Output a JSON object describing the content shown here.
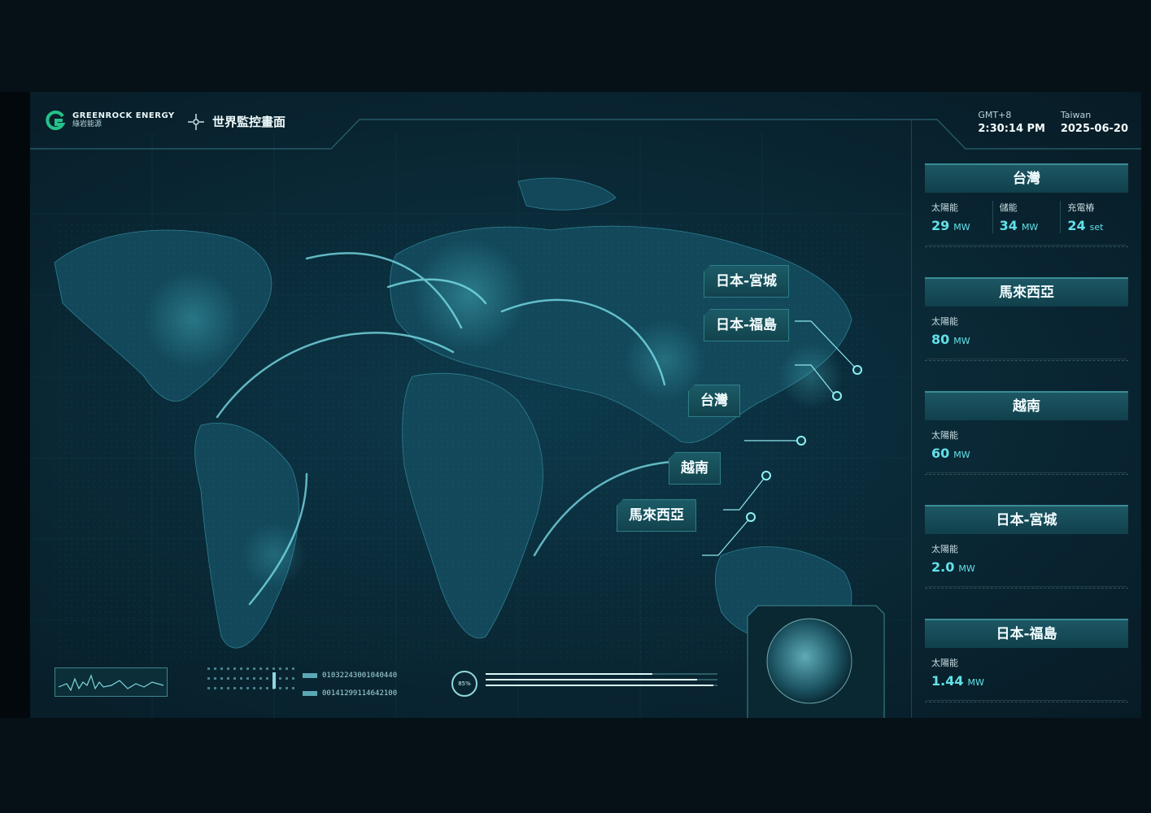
{
  "brand": {
    "name_en": "GREENROCK ENERGY",
    "name_zh": "綠岩能源"
  },
  "page_title": "世界監控畫面",
  "header": {
    "timezone_label": "GMT+8",
    "time": "2:30:14 PM",
    "location_label": "Taiwan",
    "date": "2025-06-20"
  },
  "map_callouts": [
    {
      "label": "日本-宮城"
    },
    {
      "label": "日本-福島"
    },
    {
      "label": "台灣"
    },
    {
      "label": "越南"
    },
    {
      "label": "馬來西亞"
    }
  ],
  "sites": [
    {
      "title": "台灣",
      "metrics": [
        {
          "label": "太陽能",
          "value": "29",
          "unit": "MW"
        },
        {
          "label": "儲能",
          "value": "34",
          "unit": "MW"
        },
        {
          "label": "充電樁",
          "value": "24",
          "unit": "set"
        }
      ]
    },
    {
      "title": "馬來西亞",
      "metrics": [
        {
          "label": "太陽能",
          "value": "80",
          "unit": "MW"
        }
      ]
    },
    {
      "title": "越南",
      "metrics": [
        {
          "label": "太陽能",
          "value": "60",
          "unit": "MW"
        }
      ]
    },
    {
      "title": "日本-宮城",
      "metrics": [
        {
          "label": "太陽能",
          "value": "2.0",
          "unit": "MW"
        }
      ]
    },
    {
      "title": "日本-福島",
      "metrics": [
        {
          "label": "太陽能",
          "value": "1.44",
          "unit": "MW"
        }
      ]
    }
  ],
  "hud": {
    "code_line_1": "01032243001040440",
    "code_line_2": "00141299114642100",
    "progress_percent": "85%"
  },
  "colors": {
    "accent": "#62e1e8",
    "panel_head": "#1d5764",
    "background": "#0a2a38"
  },
  "icons": [
    "greenrock-logo-icon",
    "crosshair-icon",
    "globe-icon",
    "waveform-icon"
  ]
}
